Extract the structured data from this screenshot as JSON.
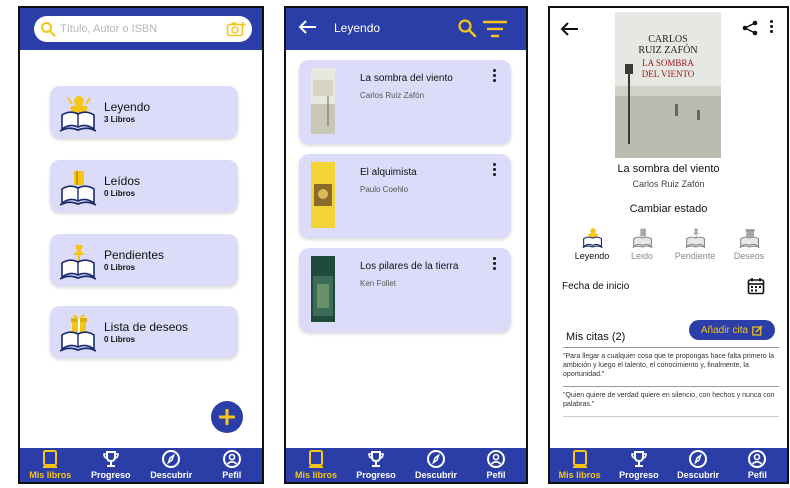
{
  "nav": {
    "items": [
      {
        "label": "Mis libros",
        "icon": "book-icon"
      },
      {
        "label": "Progreso",
        "icon": "trophy-icon"
      },
      {
        "label": "Descubrir",
        "icon": "compass-icon"
      },
      {
        "label": "Pefil",
        "icon": "profile-icon"
      }
    ],
    "active_color": "#f5c518",
    "bar_color": "#2b3ea8"
  },
  "screen1": {
    "search_placeholder": "Título, Autor o ISBN",
    "shelves": [
      {
        "name": "Leyendo",
        "count": "3 Libros"
      },
      {
        "name": "Leídos",
        "count": "0 Libros"
      },
      {
        "name": "Pendientes",
        "count": "0 Libros"
      },
      {
        "name": "Lista de deseos",
        "count": "0 Libros"
      }
    ]
  },
  "screen2": {
    "title": "Leyendo",
    "books": [
      {
        "title": "La sombra del viento",
        "author": "Carlos Ruiz Zafón"
      },
      {
        "title": "El alquimista",
        "author": "Paulo Coehlo"
      },
      {
        "title": "Los pilares de la tierra",
        "author": "Ken Follet"
      }
    ]
  },
  "screen3": {
    "cover": {
      "author_line1": "CARLOS",
      "author_line2": "RUIZ ZAFÓN",
      "title_line1": "LA SOMBRA",
      "title_line2": "DEL VIENTO"
    },
    "book_title": "La sombra del viento",
    "book_author": "Carlos Ruiz Zafón",
    "change_status": "Cambiar estado",
    "statuses": [
      {
        "label": "Leyendo",
        "active": true
      },
      {
        "label": "Leido",
        "active": false
      },
      {
        "label": "Pendiente",
        "active": false
      },
      {
        "label": "Deseos",
        "active": false
      }
    ],
    "start_date_label": "Fecha de inicio",
    "quotes_title": "Mis citas (2)",
    "add_quote_label": "Añadir cita",
    "quotes": [
      "\"Para llegar a cualquier cosa que te propongas hace falta primero la ambición y luego el talento, el conocimiento y, finalmente, la oportunidad.\"",
      "\"Quien quiere de verdad quiere en silencio, con hechos y nunca con palabras.\""
    ]
  }
}
